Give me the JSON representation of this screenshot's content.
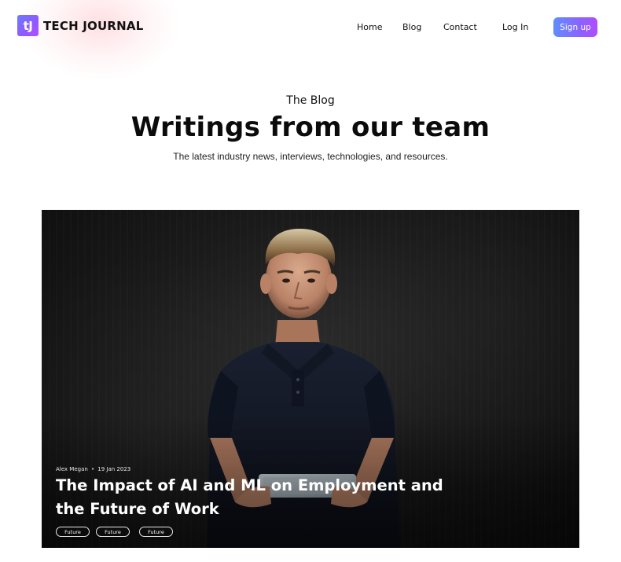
{
  "brand": {
    "mark": "tJ",
    "name": "TECH JOURNAL"
  },
  "nav": {
    "items": [
      {
        "label": "Home"
      },
      {
        "label": "Blog"
      },
      {
        "label": "Contact"
      },
      {
        "label": "Log In"
      }
    ],
    "signup_label": "Sign up"
  },
  "hero": {
    "eyebrow": "The Blog",
    "title": "Writings from our team",
    "subtitle": "The latest industry news, interviews, technologies, and resources."
  },
  "featured_post": {
    "author": "Alex Megan",
    "date": "19 Jan 2023",
    "title": "The Impact of AI and ML on Employment and the Future of Work",
    "tags": [
      "Future",
      "Future",
      "Future"
    ],
    "image": "portrait-teen-holding-tablet"
  },
  "colors": {
    "accent_start": "#5f8dff",
    "accent_end": "#b04cff",
    "text": "#111111",
    "card_bg": "#141414"
  }
}
